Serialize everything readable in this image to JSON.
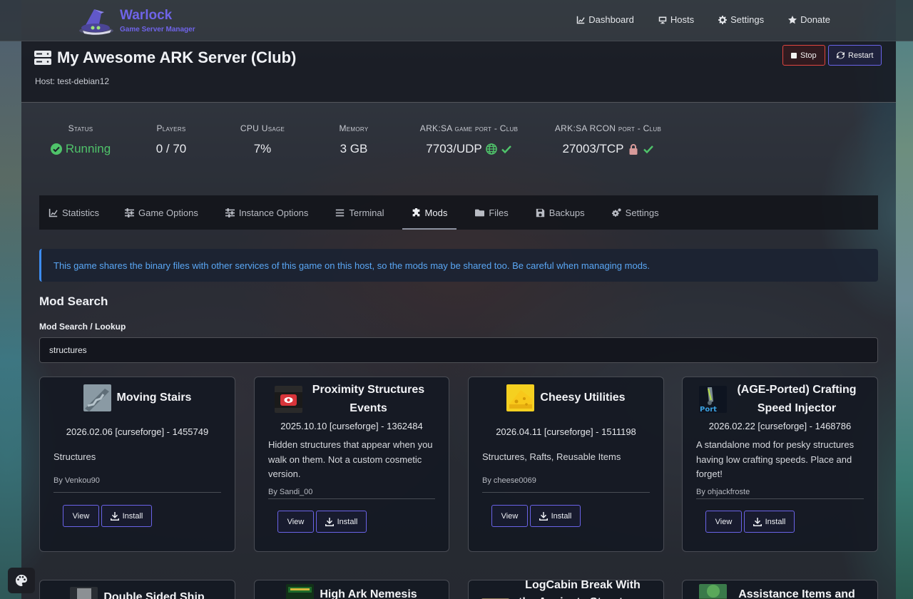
{
  "brand": {
    "title": "Warlock",
    "subtitle": "Game Server Manager"
  },
  "nav": [
    {
      "label": "Dashboard",
      "icon": "chart-line-icon"
    },
    {
      "label": "Hosts",
      "icon": "monitor-icon"
    },
    {
      "label": "Settings",
      "icon": "gear-icon"
    },
    {
      "label": "Donate",
      "icon": "star-icon"
    }
  ],
  "server": {
    "title": "My Awesome ARK Server (Club)",
    "host": "Host: test-debian12",
    "stop_label": "Stop",
    "restart_label": "Restart"
  },
  "stats": [
    {
      "label": "Status",
      "value": "Running",
      "icon": "check-circle-icon",
      "color": "#4fc36a"
    },
    {
      "label": "Players",
      "value": "0 / 70"
    },
    {
      "label": "CPU Usage",
      "value": "7%"
    },
    {
      "label": "Memory",
      "value": "3 GB"
    },
    {
      "label": "ARK:SA game port - Club",
      "value": "7703/UDP",
      "icons": [
        "globe-icon",
        "check-icon"
      ]
    },
    {
      "label": "ARK:SA RCON port - Club",
      "value": "27003/TCP",
      "icons": [
        "lock-icon",
        "check-icon"
      ]
    }
  ],
  "tabs": [
    {
      "label": "Statistics",
      "icon": "chart-line-icon"
    },
    {
      "label": "Game Options",
      "icon": "sliders-icon"
    },
    {
      "label": "Instance Options",
      "icon": "sliders-icon"
    },
    {
      "label": "Terminal",
      "icon": "list-icon"
    },
    {
      "label": "Mods",
      "icon": "puzzle-icon",
      "active": true
    },
    {
      "label": "Files",
      "icon": "folder-icon"
    },
    {
      "label": "Backups",
      "icon": "save-icon"
    },
    {
      "label": "Settings",
      "icon": "gears-icon"
    }
  ],
  "alert": "This game shares the binary files with other services of this game on this host, so the mods may be shared too. Be careful when managing mods.",
  "mod_search": {
    "section_title": "Mod Search",
    "field_label": "Mod Search / Lookup",
    "value": "structures"
  },
  "mods": [
    {
      "title": "Moving Stairs",
      "meta": "2026.02.06 [curseforge] - 1455749",
      "desc": "Structures",
      "author": "By Venkou90",
      "view": "View",
      "install": "Install"
    },
    {
      "title": "Proximity Structures Events",
      "meta": "2025.10.10 [curseforge] - 1362484",
      "desc": "Hidden structures that appear when you walk on them. Not a custom cosmetic version.",
      "author": "By Sandi_00",
      "view": "View",
      "install": "Install"
    },
    {
      "title": "Cheesy Utilities",
      "meta": "2026.04.11 [curseforge] - 1511198",
      "desc": "Structures, Rafts, Reusable Items",
      "author": "By cheese0069",
      "view": "View",
      "install": "Install"
    },
    {
      "title": "(AGE-Ported) Crafting Speed Injector",
      "meta": "2026.02.22 [curseforge] - 1468786",
      "desc": "A standalone mod for pesky structures having low crafting speeds. Place and forget!",
      "author": "By ohjackfroste",
      "view": "View",
      "install": "Install"
    }
  ],
  "mods_row2": [
    {
      "title": "Double Sided Ship"
    },
    {
      "title": "High Ark Nemesis"
    },
    {
      "title": "LogCabin Break With the Ancients Structures and"
    },
    {
      "title": "Assistance Items and"
    }
  ],
  "colors": {
    "accent": "#6f64e8",
    "running": "#4fc36a",
    "stop": "#e0453f",
    "info": "#5aa7f5"
  }
}
